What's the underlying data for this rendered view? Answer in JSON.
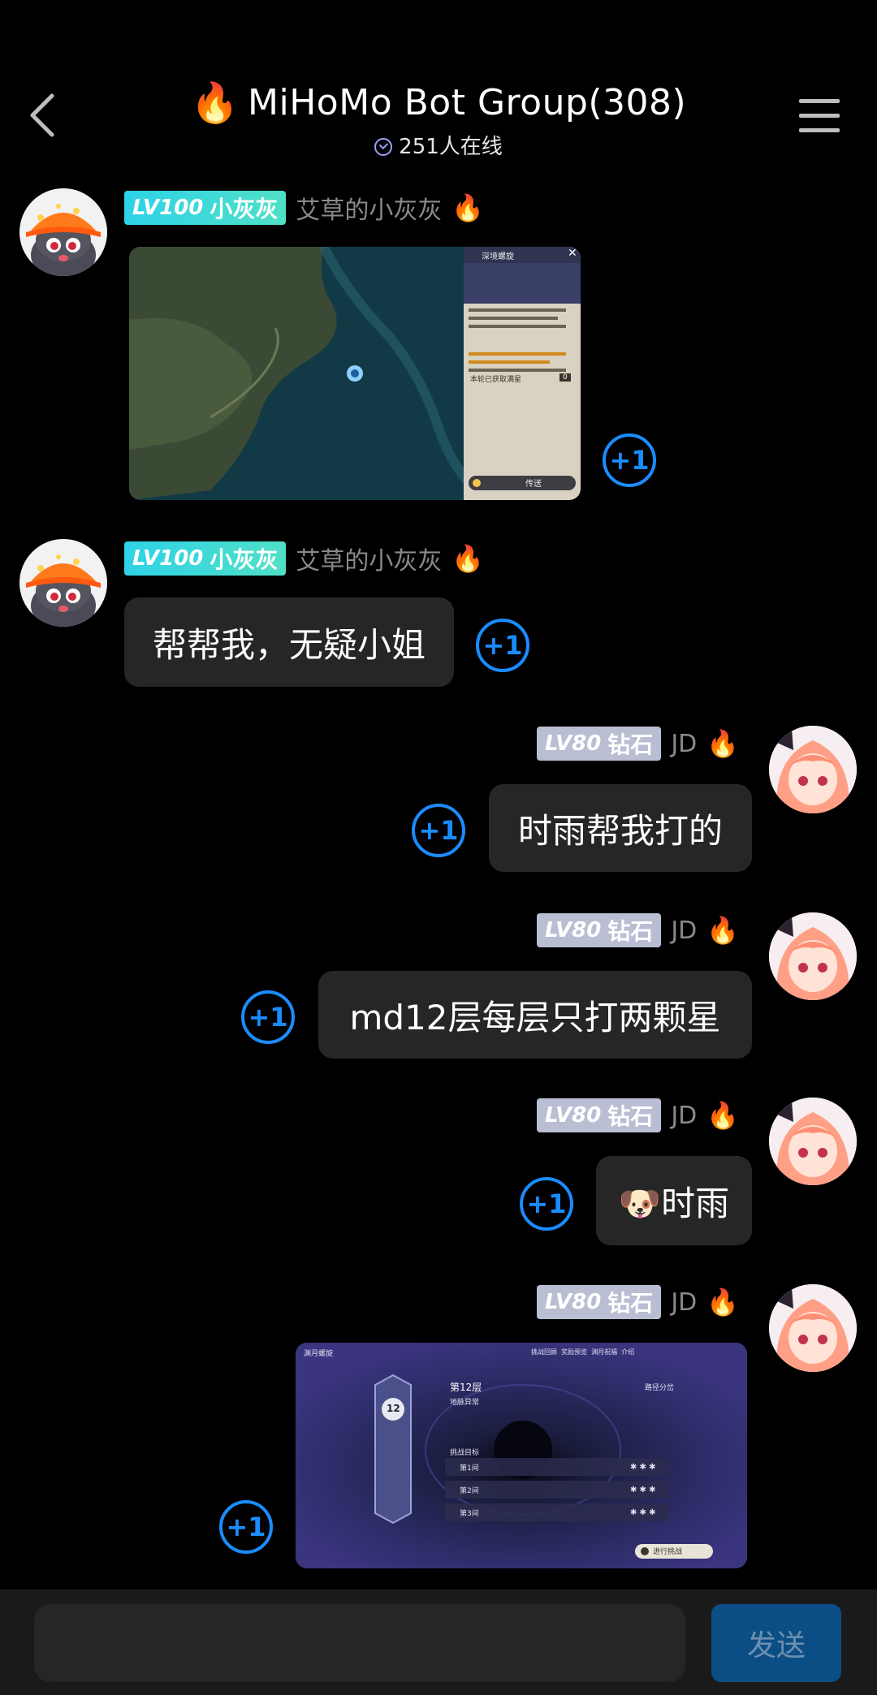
{
  "header": {
    "title": "MiHoMo Bot Group(308)",
    "online": "251人在线"
  },
  "messages": [
    {
      "badge_level": "LV100",
      "badge_title": "小灰灰",
      "nickname": "艾草的小灰灰",
      "plus": "+1",
      "image_panel": {
        "title": "深境螺旋",
        "stars_label": "本轮已获取满星",
        "stars_count": "0",
        "teleport": "传送"
      }
    },
    {
      "badge_level": "LV100",
      "badge_title": "小灰灰",
      "nickname": "艾草的小灰灰",
      "text": "帮帮我，无疑小姐",
      "plus": "+1"
    },
    {
      "badge_level": "LV80",
      "badge_title": "钻石",
      "nickname": "JD",
      "text": "时雨帮我打的",
      "plus": "+1"
    },
    {
      "badge_level": "LV80",
      "badge_title": "钻石",
      "nickname": "JD",
      "text": "md12层每层只打两颗星",
      "plus": "+1"
    },
    {
      "badge_level": "LV80",
      "badge_title": "钻石",
      "nickname": "JD",
      "text": "🐶时雨",
      "plus": "+1"
    },
    {
      "badge_level": "LV80",
      "badge_title": "钻石",
      "nickname": "JD",
      "plus": "+1",
      "image_panel": {
        "top_left": "渊月螺旋",
        "floor": "第12层",
        "path": "路径分岔",
        "anomaly": "地脉异常",
        "challenge": "挑战目标",
        "rooms": [
          "第1间",
          "第2间",
          "第3间"
        ],
        "floor_num": "12",
        "start": "进行挑战",
        "nav": [
          "挑战回顾",
          "奖励预览",
          "渊月祝福",
          "介绍"
        ]
      }
    }
  ],
  "input": {
    "send_label": "发送"
  },
  "colors": {
    "background": "#000000",
    "bubble": "#262626",
    "accent": "#1a8cff",
    "send_bg": "#0b4e86"
  }
}
